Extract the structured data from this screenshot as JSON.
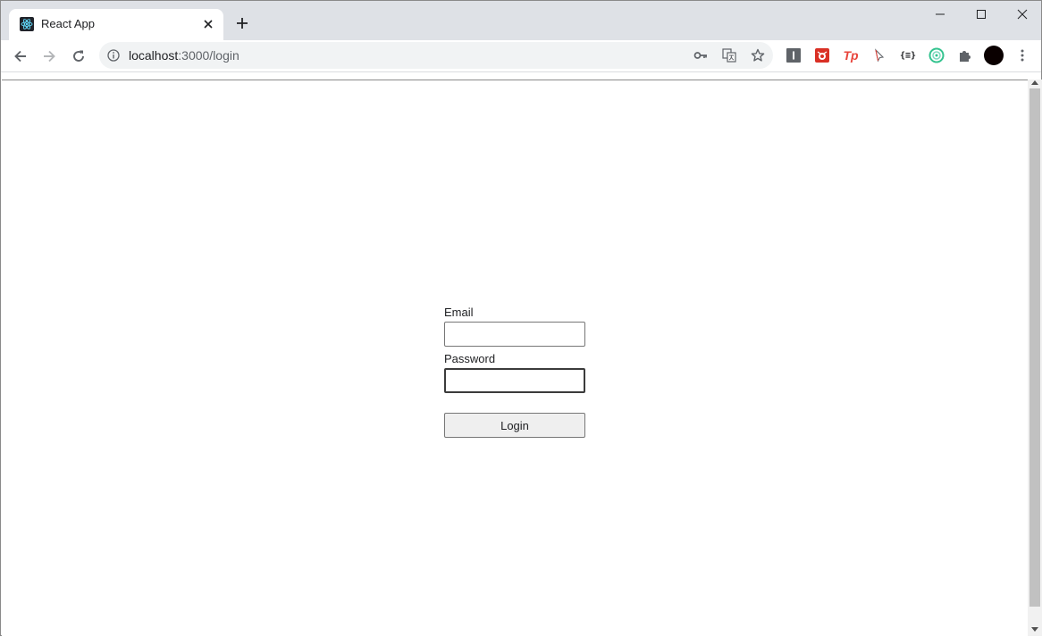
{
  "browser": {
    "tab": {
      "title": "React App",
      "favicon": "react-logo-icon",
      "close_icon": "close-icon"
    },
    "new_tab_icon": "plus-icon",
    "window_controls": [
      "minimize-icon",
      "maximize-icon",
      "close-icon"
    ],
    "nav": {
      "back": "arrow-left-icon",
      "forward": "arrow-right-icon",
      "reload": "reload-icon"
    },
    "address": {
      "host": "localhost",
      "path": ":3000/login"
    },
    "omnibox_icons": [
      "key-icon",
      "translate-icon",
      "star-icon"
    ],
    "extensions": [
      {
        "name": "instapaper-icon",
        "text": "I",
        "color": "#5f6368"
      },
      {
        "name": "bug-ext-icon",
        "text": "",
        "color": "#d93025"
      },
      {
        "name": "tp-ext-icon",
        "text": "Tp",
        "color": "#e8453c"
      },
      {
        "name": "cursor-ext-icon",
        "text": "",
        "color": "#5f6368"
      },
      {
        "name": "json-ext-icon",
        "text": "{≡}",
        "color": "#202124"
      },
      {
        "name": "circle-ext-icon",
        "text": "",
        "color": "#34c38f"
      },
      {
        "name": "puzzle-icon",
        "text": "",
        "color": "#5f6368"
      }
    ],
    "profile_color": "#000000"
  },
  "login": {
    "email_label": "Email",
    "email_value": "",
    "password_label": "Password",
    "password_value": "",
    "submit_label": "Login"
  }
}
